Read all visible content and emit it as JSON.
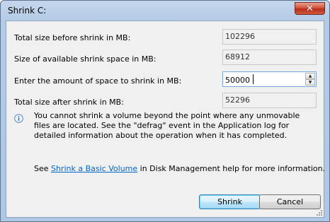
{
  "window": {
    "title": "Shrink C:",
    "close_label": "✕"
  },
  "fields": {
    "total_before_label": "Total size before shrink in MB:",
    "total_before_value": "102296",
    "available_label": "Size of available shrink space in MB:",
    "available_value": "68912",
    "amount_label": "Enter the amount of space to shrink in MB:",
    "amount_value": "50000",
    "total_after_label": "Total size after shrink in MB:",
    "total_after_value": "52296"
  },
  "info": {
    "icon": "info-icon",
    "text": "You cannot shrink a volume beyond the point where any unmovable files are located. See the \"defrag\" event in the Application log for detailed information about the operation when it has completed."
  },
  "help": {
    "prefix": "See ",
    "link": "Shrink a Basic Volume",
    "suffix": " in Disk Management help for more information."
  },
  "buttons": {
    "shrink": "Shrink",
    "cancel": "Cancel"
  },
  "colors": {
    "link": "#0066cc",
    "close": "#c8432b",
    "focus_border": "#7aa7d6"
  }
}
